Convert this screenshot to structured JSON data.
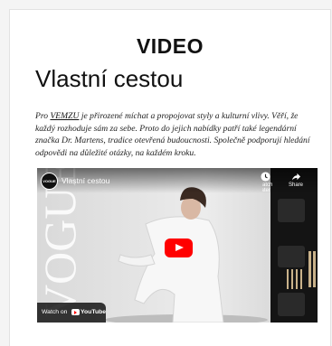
{
  "section": {
    "heading": "VIDEO"
  },
  "article": {
    "title": "Vlastní cestou",
    "body_before_link": "Pro ",
    "link_text": "VEMZU",
    "body_after_link": " je přirozené míchat a propojovat styly a kulturní vlivy. Věří, že každý rozhoduje sám za sebe. Proto do jejich nabídky patří také legendární značka Dr. Martens, tradice otevřená budoucnosti. Společně podporují hledání odpovědi na důležité otázky, na každém kroku."
  },
  "video": {
    "title": "Vlastní cestou",
    "channel_avatar_text": "VOGUE",
    "watch_later_label": "Watch later",
    "share_label": "Share",
    "watch_on_label": "Watch on",
    "youtube_label": "YouTube",
    "background_word": "VOGUE",
    "icons": [
      "clock-icon",
      "share-icon",
      "play-icon",
      "youtube-logo-icon"
    ]
  },
  "colors": {
    "youtube_red": "#ff0000",
    "text": "#111111"
  }
}
